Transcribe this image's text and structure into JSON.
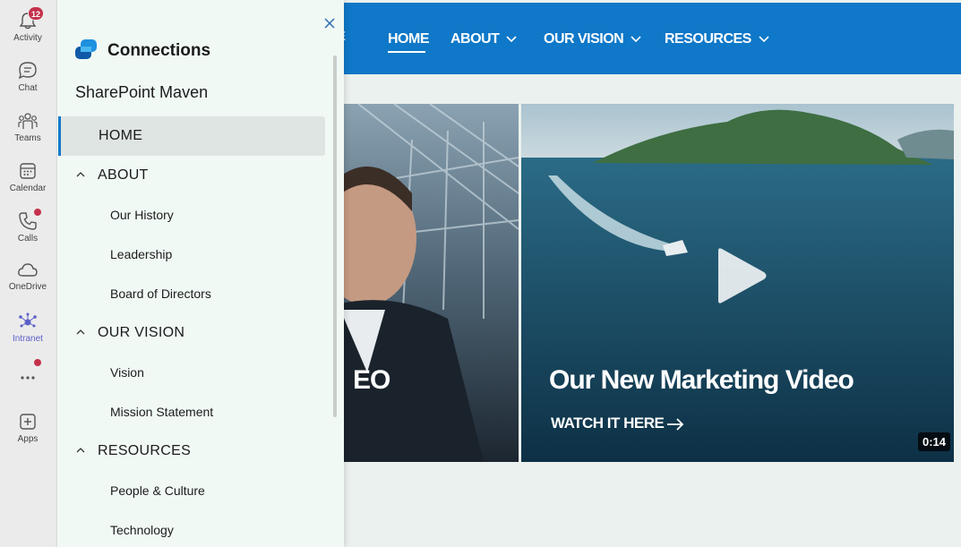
{
  "rail": {
    "items": [
      {
        "label": "Activity",
        "icon": "bell-icon",
        "badge": "12"
      },
      {
        "label": "Chat",
        "icon": "chat-icon"
      },
      {
        "label": "Teams",
        "icon": "teams-icon"
      },
      {
        "label": "Calendar",
        "icon": "calendar-icon"
      },
      {
        "label": "Calls",
        "icon": "phone-icon"
      },
      {
        "label": "OneDrive",
        "icon": "cloud-icon"
      },
      {
        "label": "Intranet",
        "icon": "connections-icon"
      },
      {
        "label": "Apps",
        "icon": "add-app-icon"
      }
    ]
  },
  "topnav": {
    "items": [
      "HOME",
      "ABOUT",
      "OUR VISION",
      "RESOURCES"
    ],
    "cut_text": "E"
  },
  "panel": {
    "title": "Connections",
    "site_name": "SharePoint Maven",
    "nav": {
      "home": "HOME",
      "about": "ABOUT",
      "our_history": "Our History",
      "leadership": "Leadership",
      "board": "Board of Directors",
      "our_vision": "OUR VISION",
      "vision": "Vision",
      "mission": "Mission Statement",
      "resources": "RESOURCES",
      "people": "People & Culture",
      "technology": "Technology"
    }
  },
  "videos": {
    "left_title_partial": "EO",
    "right_title": "Our New Marketing Video",
    "right_link": "WATCH IT HERE",
    "right_duration": "0:14"
  },
  "colors": {
    "accent_blue": "#0f78c8",
    "badge_red": "#c4314b",
    "teams_purple": "#5b5fc7",
    "panel_bg": "#f1f9f5",
    "page_bg": "#ebf1ee"
  }
}
